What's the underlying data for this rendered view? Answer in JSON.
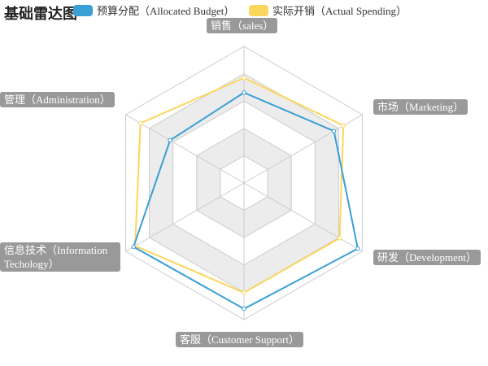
{
  "chart_data": {
    "type": "radar",
    "title": "基础雷达图",
    "legend": [
      "预算分配（Allocated Budget）",
      "实际开销（Actual Spending）"
    ],
    "legend_placement": "top",
    "split_number": 5,
    "indicators": [
      {
        "name": "销售（sales）",
        "max": 6500
      },
      {
        "name": "管理（Administration）",
        "max": 16000
      },
      {
        "name": "信息技术（Information Techology）",
        "max": 30000
      },
      {
        "name": "客服（Customer Support）",
        "max": 38000
      },
      {
        "name": "研发（Development）",
        "max": 52000
      },
      {
        "name": "市场（Marketing）",
        "max": 25000
      }
    ],
    "series": [
      {
        "name": "预算分配（Allocated Budget）",
        "color": "#3a9fd5",
        "values": [
          4300,
          10000,
          28000,
          35000,
          50000,
          19000
        ]
      },
      {
        "name": "实际开销（Actual Spending）",
        "color": "#fbd65c",
        "values": [
          5000,
          14000,
          27600,
          30500,
          42000,
          21000
        ]
      }
    ]
  }
}
